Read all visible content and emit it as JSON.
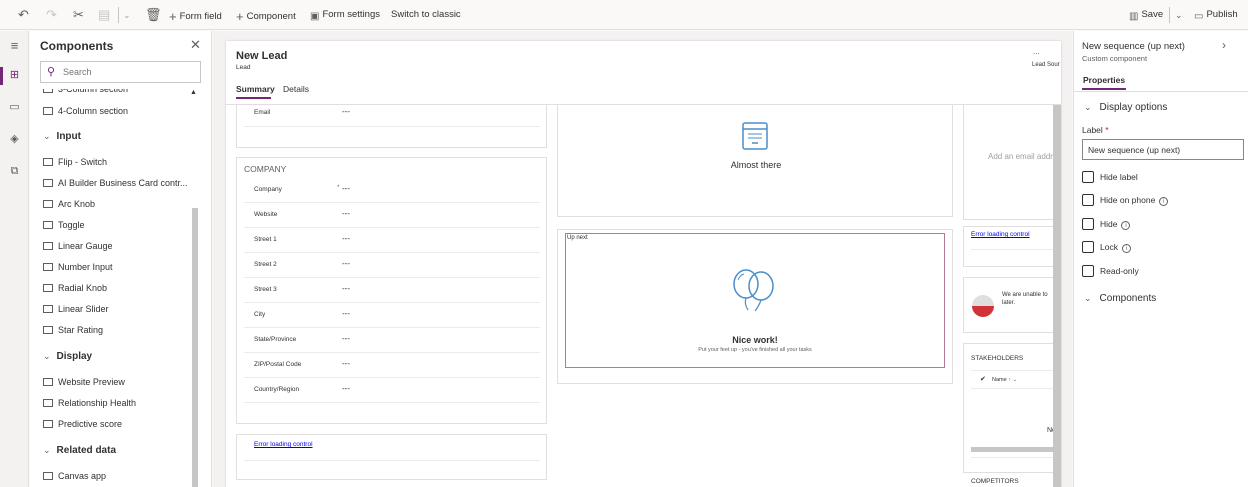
{
  "toolbar": {
    "undo": "undo-icon",
    "redo": "redo-icon",
    "cut": "cut-icon",
    "paste": "paste-icon",
    "delete": "delete-icon",
    "form_field": "Form field",
    "component": "Component",
    "form_settings": "Form settings",
    "switch_classic": "Switch to classic",
    "save": "Save",
    "publish": "Publish"
  },
  "components_panel": {
    "title": "Components",
    "search_placeholder": "Search",
    "items_layout": [
      "3-Column section",
      "4-Column section"
    ],
    "sections": {
      "input": {
        "label": "Input",
        "items": [
          "Flip - Switch",
          "AI Builder Business Card contr...",
          "Arc Knob",
          "Toggle",
          "Linear Gauge",
          "Number Input",
          "Radial Knob",
          "Linear Slider",
          "Star Rating"
        ]
      },
      "display": {
        "label": "Display",
        "items": [
          "Website Preview",
          "Relationship Health",
          "Predictive score"
        ]
      },
      "related_data": {
        "label": "Related data",
        "items": [
          "Canvas app"
        ]
      }
    }
  },
  "form": {
    "title": "New Lead",
    "subtitle": "Lead",
    "more": "...",
    "right_label": "Lead Sour",
    "tabs": [
      "Summary",
      "Details"
    ],
    "email_label": "Email",
    "empty_value": "---",
    "company_section": {
      "title": "COMPANY",
      "fields": [
        "Company",
        "Website",
        "Street 1",
        "Street 2",
        "Street 3",
        "City",
        "State/Province",
        "ZIP/Postal Code",
        "Country/Region"
      ],
      "required_mark": "*"
    },
    "error_loading": "Error loading control",
    "almost_there": "Almost there",
    "up_next": {
      "label": "Up next",
      "title": "Nice work!",
      "subtitle": "Put your feet up - you've finished all your tasks"
    },
    "email_placeholder": "Add an email addre",
    "unable_message": "We are unable to",
    "unable_message2": "later.",
    "stakeholders": "STAKEHOLDERS",
    "name_col": "Name",
    "no_text": "No",
    "competitors": "COMPETITORS"
  },
  "properties": {
    "title": "New sequence (up next)",
    "subtitle": "Custom component",
    "tab": "Properties",
    "display_options": "Display options",
    "label_caption": "Label",
    "label_required": "*",
    "label_value": "New sequence (up next)",
    "checkboxes": [
      "Hide label",
      "Hide on phone",
      "Hide",
      "Lock",
      "Read-only"
    ],
    "components": "Components"
  },
  "colors": {
    "accent": "#742774",
    "error_red": "#d13438"
  }
}
